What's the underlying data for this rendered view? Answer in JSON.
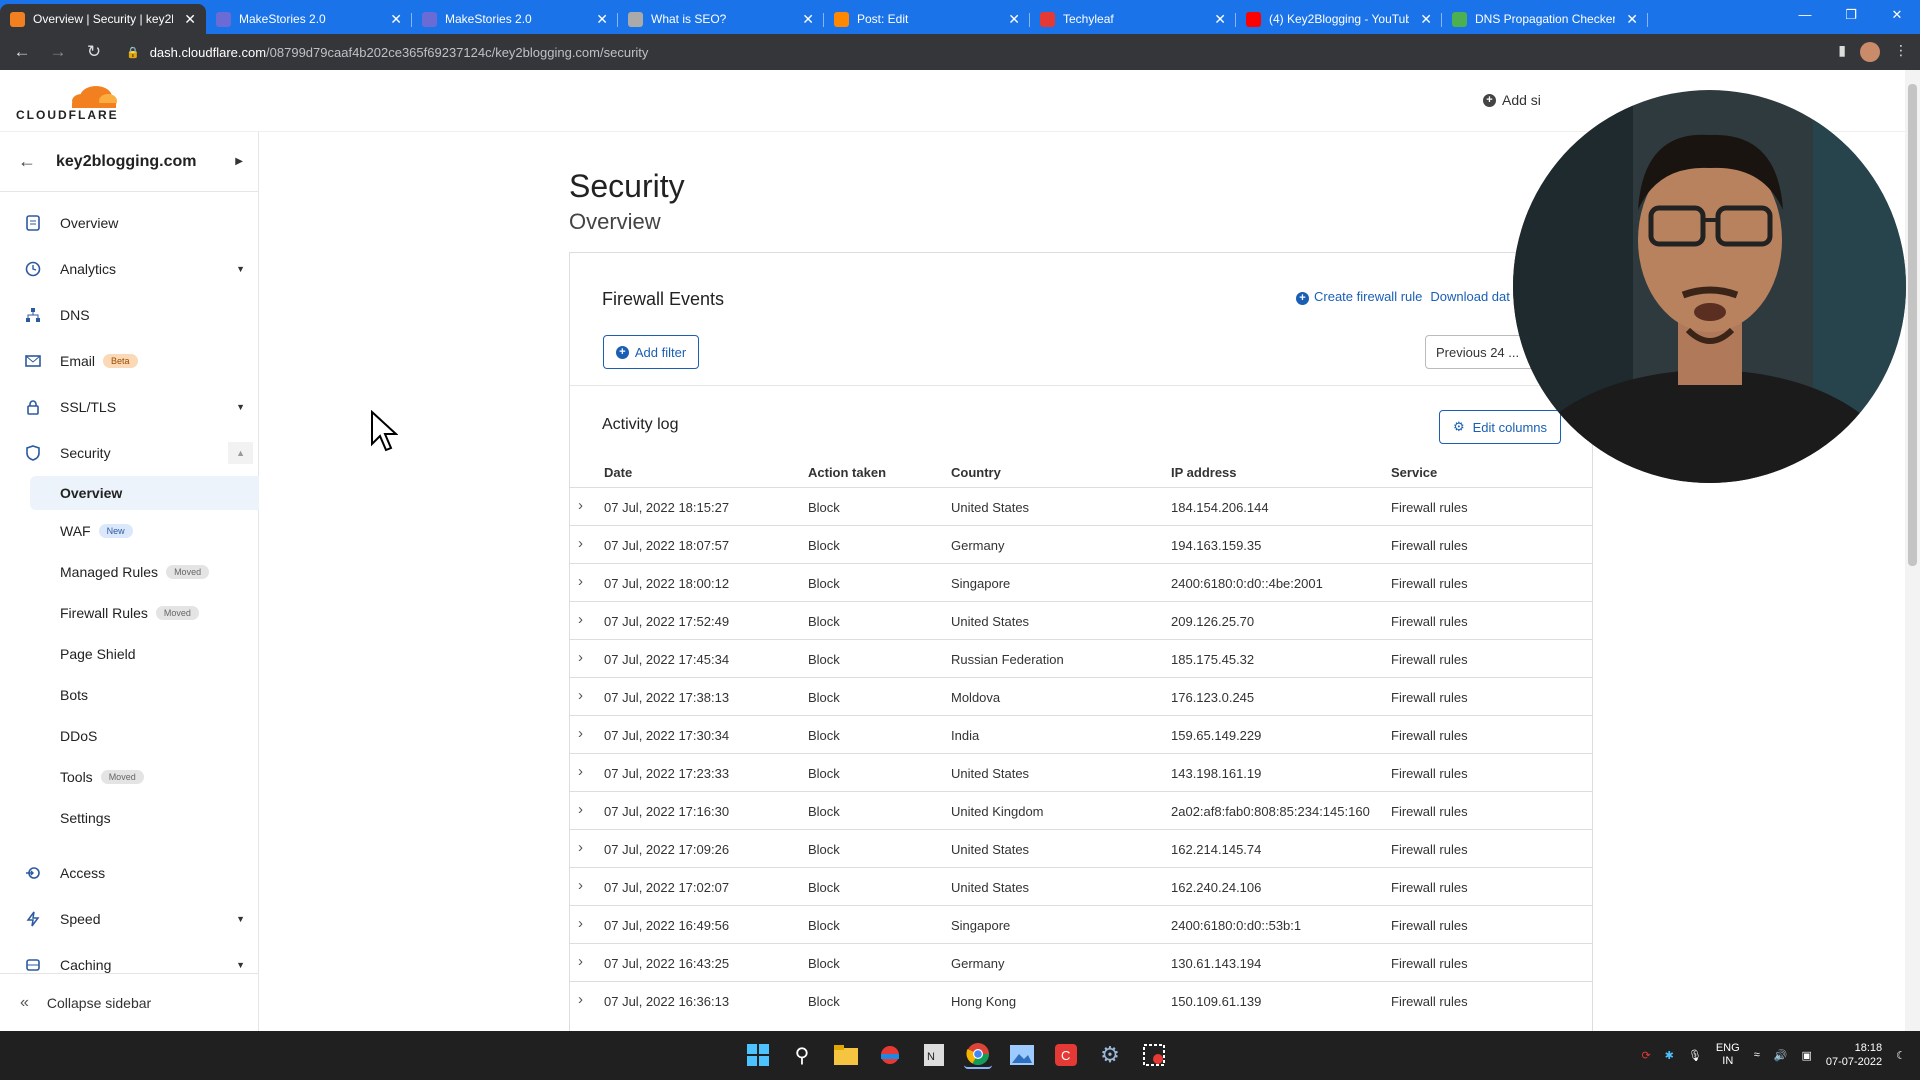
{
  "browser": {
    "tabs": [
      {
        "title": "Overview | Security | key2b",
        "icon": "cloudflare-favicon",
        "color": "#f38020"
      },
      {
        "title": "MakeStories 2.0",
        "icon": "makestories-favicon",
        "color": "#6b6bd6"
      },
      {
        "title": "MakeStories 2.0",
        "icon": "makestories-favicon",
        "color": "#6b6bd6"
      },
      {
        "title": "What is SEO?",
        "icon": "loading-favicon",
        "color": "#aaaaaa"
      },
      {
        "title": "Post: Edit",
        "icon": "blogger-favicon",
        "color": "#ff8800"
      },
      {
        "title": "Techyleaf",
        "icon": "techyleaf-favicon",
        "color": "#e53935"
      },
      {
        "title": "(4) Key2Blogging - YouTub",
        "icon": "youtube-favicon",
        "color": "#ff0000"
      },
      {
        "title": "DNS Propagation Checker",
        "icon": "dns-checker-favicon",
        "color": "#4caf50"
      }
    ],
    "url_host": "dash.cloudflare.com",
    "url_path": "/08799d79caaf4b202ce365f69237124c/key2blogging.com/security"
  },
  "header": {
    "logo_text": "CLOUDFLARE",
    "add_site": "Add si"
  },
  "sidebar": {
    "domain": "key2blogging.com",
    "items": [
      {
        "label": "Overview",
        "icon": "document-icon"
      },
      {
        "label": "Analytics",
        "icon": "clock-icon",
        "dropdown": true
      },
      {
        "label": "DNS",
        "icon": "network-icon"
      },
      {
        "label": "Email",
        "icon": "envelope-icon",
        "badge": "Beta"
      },
      {
        "label": "SSL/TLS",
        "icon": "lock-icon",
        "dropdown": true
      },
      {
        "label": "Security",
        "icon": "shield-icon",
        "expanded": true
      }
    ],
    "security_sub": [
      {
        "label": "Overview",
        "active": true
      },
      {
        "label": "WAF",
        "badge": "New"
      },
      {
        "label": "Managed Rules",
        "badge": "Moved"
      },
      {
        "label": "Firewall Rules",
        "badge": "Moved"
      },
      {
        "label": "Page Shield"
      },
      {
        "label": "Bots"
      },
      {
        "label": "DDoS"
      },
      {
        "label": "Tools",
        "badge": "Moved"
      },
      {
        "label": "Settings"
      }
    ],
    "items_after": [
      {
        "label": "Access",
        "icon": "access-icon"
      },
      {
        "label": "Speed",
        "icon": "lightning-icon",
        "dropdown": true
      },
      {
        "label": "Caching",
        "icon": "caching-icon",
        "dropdown": true
      }
    ],
    "collapse_label": "Collapse sidebar"
  },
  "main": {
    "title": "Security",
    "subtitle": "Overview",
    "firewall_events_title": "Firewall Events",
    "create_rule": "Create firewall rule",
    "download": "Download dat",
    "add_filter": "Add filter",
    "time_range": "Previous 24 ...",
    "activity_log_title": "Activity log",
    "edit_columns": "Edit columns",
    "columns": [
      "Date",
      "Action taken",
      "Country",
      "IP address",
      "Service"
    ],
    "rows": [
      [
        "07 Jul, 2022 18:15:27",
        "Block",
        "United States",
        "184.154.206.144",
        "Firewall rules"
      ],
      [
        "07 Jul, 2022 18:07:57",
        "Block",
        "Germany",
        "194.163.159.35",
        "Firewall rules"
      ],
      [
        "07 Jul, 2022 18:00:12",
        "Block",
        "Singapore",
        "2400:6180:0:d0::4be:2001",
        "Firewall rules"
      ],
      [
        "07 Jul, 2022 17:52:49",
        "Block",
        "United States",
        "209.126.25.70",
        "Firewall rules"
      ],
      [
        "07 Jul, 2022 17:45:34",
        "Block",
        "Russian Federation",
        "185.175.45.32",
        "Firewall rules"
      ],
      [
        "07 Jul, 2022 17:38:13",
        "Block",
        "Moldova",
        "176.123.0.245",
        "Firewall rules"
      ],
      [
        "07 Jul, 2022 17:30:34",
        "Block",
        "India",
        "159.65.149.229",
        "Firewall rules"
      ],
      [
        "07 Jul, 2022 17:23:33",
        "Block",
        "United States",
        "143.198.161.19",
        "Firewall rules"
      ],
      [
        "07 Jul, 2022 17:16:30",
        "Block",
        "United Kingdom",
        "2a02:af8:fab0:808:85:234:145:160",
        "Firewall rules"
      ],
      [
        "07 Jul, 2022 17:09:26",
        "Block",
        "United States",
        "162.214.145.74",
        "Firewall rules"
      ],
      [
        "07 Jul, 2022 17:02:07",
        "Block",
        "United States",
        "162.240.24.106",
        "Firewall rules"
      ],
      [
        "07 Jul, 2022 16:49:56",
        "Block",
        "Singapore",
        "2400:6180:0:d0::53b:1",
        "Firewall rules"
      ],
      [
        "07 Jul, 2022 16:43:25",
        "Block",
        "Germany",
        "130.61.143.194",
        "Firewall rules"
      ],
      [
        "07 Jul, 2022 16:36:13",
        "Block",
        "Hong Kong",
        "150.109.61.139",
        "Firewall rules"
      ]
    ]
  },
  "taskbar": {
    "lang_top": "ENG",
    "lang_bottom": "IN",
    "time": "18:18",
    "date": "07-07-2022"
  },
  "colors": {
    "accent": "#1a5fb4",
    "chrome_blue": "#1a73e8",
    "cloudflare_orange": "#f38020"
  }
}
